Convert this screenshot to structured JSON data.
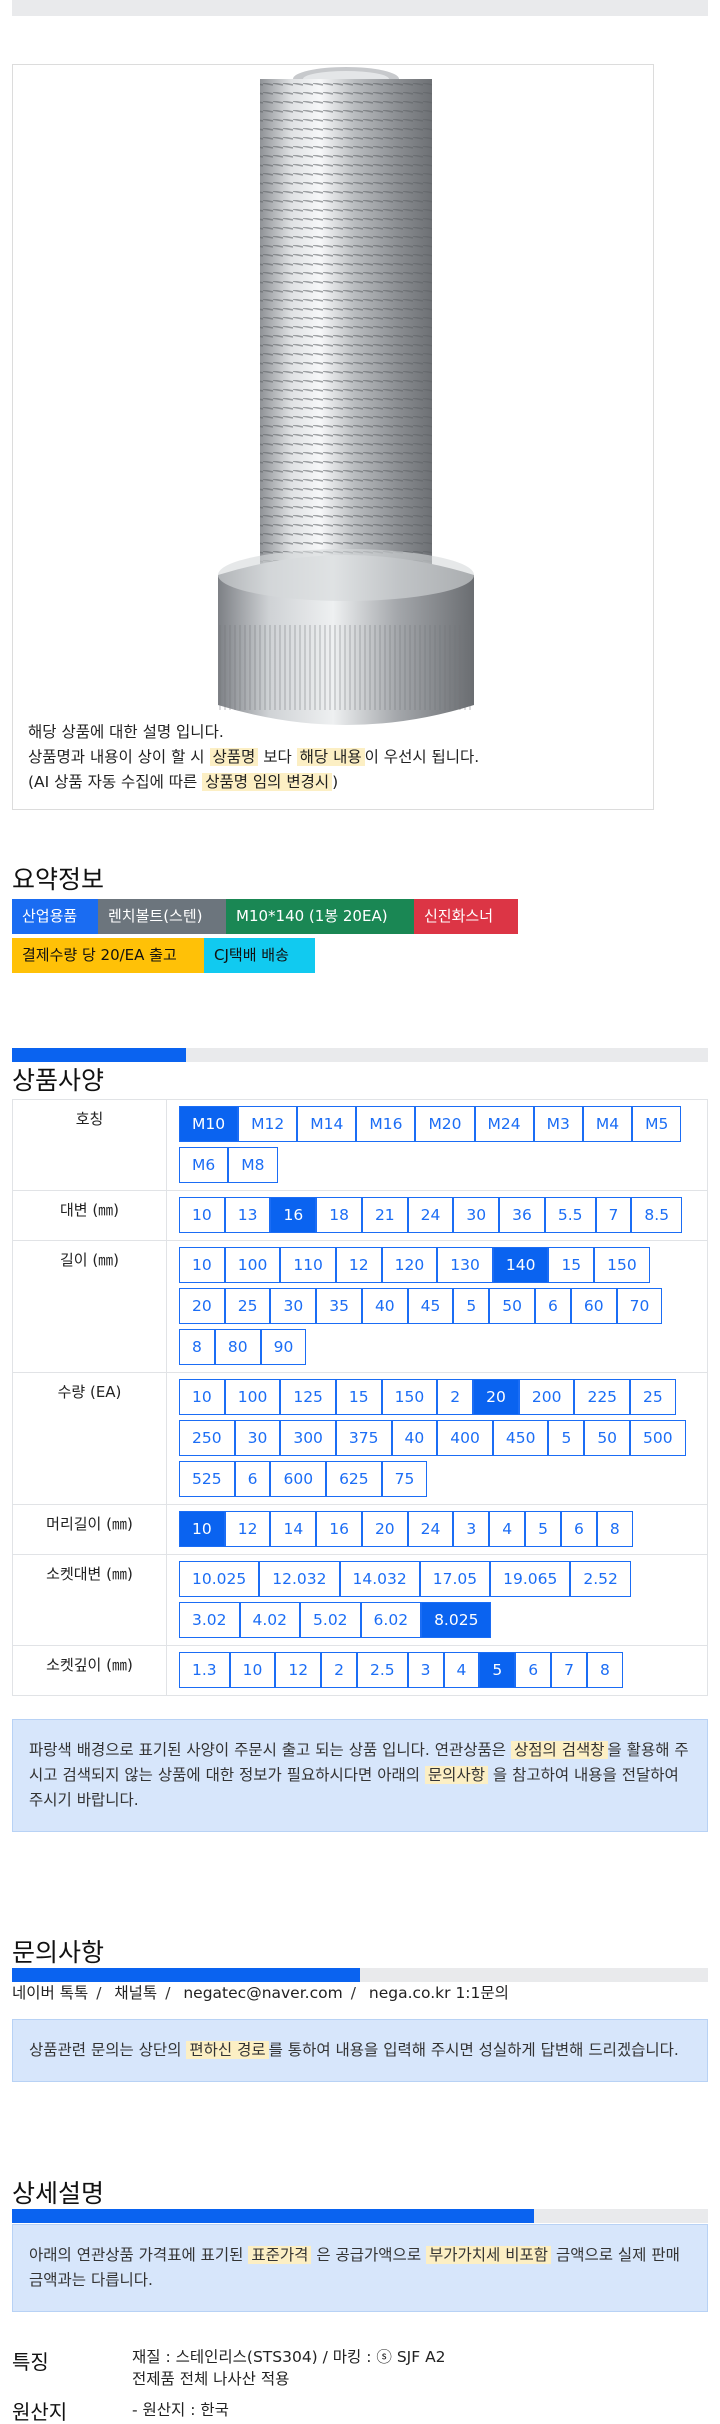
{
  "product_desc": {
    "line1": "해당 상품에 대한 설명 입니다.",
    "line2_a": "상품명과 내용이 상이 할 시 ",
    "line2_hl1": "상품명",
    "line2_b": " 보다 ",
    "line2_hl2": "해당 내용",
    "line2_c": "이 우선시 됩니다.",
    "line3_a": "(AI 상품 자동 수집에 따른 ",
    "line3_hl": "상품명 임의 변경시",
    "line3_b": ")"
  },
  "summary": {
    "title": "요약정보",
    "tags": [
      {
        "label": "산업용품",
        "color": "#1a6cf2"
      },
      {
        "label": "렌치볼트(스텐)",
        "color": "#6c757d"
      },
      {
        "label": "M10*140 (1봉 20EA)",
        "color": "#1a8754"
      },
      {
        "label": "신진화스너",
        "color": "#dc3545"
      },
      {
        "label": "결제수량 당 20/EA 출고",
        "color": "#ffc107"
      },
      {
        "label": "CJ택배 배송",
        "color": "#11caf0"
      }
    ]
  },
  "spec": {
    "title": "상품사양",
    "progress": 0.25,
    "rows": [
      {
        "label": "호칭",
        "options": [
          "M10",
          "M12",
          "M14",
          "M16",
          "M20",
          "M24",
          "M3",
          "M4",
          "M5",
          "M6",
          "M8"
        ],
        "selected": "M10"
      },
      {
        "label": "대변 (㎜)",
        "options": [
          "10",
          "13",
          "16",
          "18",
          "21",
          "24",
          "30",
          "36",
          "5.5",
          "7",
          "8.5"
        ],
        "selected": "16"
      },
      {
        "label": "길이 (㎜)",
        "options": [
          "10",
          "100",
          "110",
          "12",
          "120",
          "130",
          "140",
          "15",
          "150",
          "20",
          "25",
          "30",
          "35",
          "40",
          "45",
          "5",
          "50",
          "6",
          "60",
          "70",
          "8",
          "80",
          "90"
        ],
        "selected": "140"
      },
      {
        "label": "수량 (EA)",
        "options": [
          "10",
          "100",
          "125",
          "15",
          "150",
          "2",
          "20",
          "200",
          "225",
          "25",
          "250",
          "30",
          "300",
          "375",
          "40",
          "400",
          "450",
          "5",
          "50",
          "500",
          "525",
          "6",
          "600",
          "625",
          "75"
        ],
        "selected": "20"
      },
      {
        "label": "머리길이 (㎜)",
        "options": [
          "10",
          "12",
          "14",
          "16",
          "20",
          "24",
          "3",
          "4",
          "5",
          "6",
          "8"
        ],
        "selected": "10"
      },
      {
        "label": "소켓대변 (㎜)",
        "options": [
          "10.025",
          "12.032",
          "14.032",
          "17.05",
          "19.065",
          "2.52",
          "3.02",
          "4.02",
          "5.02",
          "6.02",
          "8.025"
        ],
        "selected": "8.025"
      },
      {
        "label": "소켓깊이 (㎜)",
        "options": [
          "1.3",
          "10",
          "12",
          "2",
          "2.5",
          "3",
          "4",
          "5",
          "6",
          "7",
          "8"
        ],
        "selected": "5"
      }
    ],
    "note_a": "파랑색 배경으로 표기된 사양이 주문시 출고 되는 상품 입니다. 연관상품은 ",
    "note_hl1": "상점의 검색창",
    "note_b": "을 활용해 주시고 검색되지 않는 상품에 대한 정보가 필요하시다면 아래의 ",
    "note_hl2": "문의사항",
    "note_c": " 을 참고하여 내용을 전달하여 주시기 바랍니다."
  },
  "inquiry": {
    "title": "문의사항",
    "progress": 0.5,
    "contacts": [
      "네이버 톡톡",
      "채널톡",
      "negatec@naver.com",
      "nega.co.kr 1:1문의"
    ],
    "note_a": "상품관련 문의는 상단의 ",
    "note_hl": "편하신 경로",
    "note_b": "를 통하여 내용을 입력해 주시면 성실하게 답변해 드리겠습니다."
  },
  "detail": {
    "title": "상세설명",
    "progress": 0.75,
    "note_a": "아래의 연관상품 가격표에 표기된 ",
    "note_hl1": "표준가격",
    "note_b": " 은 공급가액으로 ",
    "note_hl2": "부가가치세 비포함",
    "note_c": " 금액으로 실제 판매금액과는 다릅니다.",
    "features_label": "특징",
    "features_line1": "재질 : 스테인리스(STS304) / 마킹 : ⓢ SJF A2",
    "features_line2": "전제품 전체 나사산 적용",
    "origin_label": "원산지",
    "origin_value": "- 원산지 : 한국"
  }
}
